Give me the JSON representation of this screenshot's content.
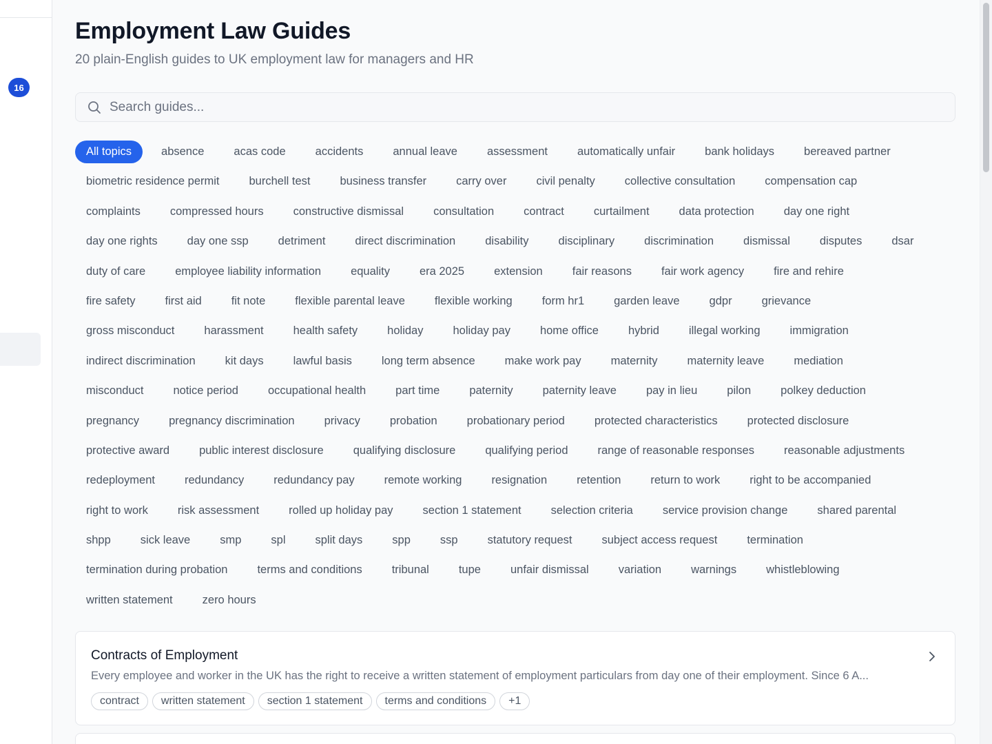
{
  "sidebar": {
    "badge_count": "16"
  },
  "header": {
    "title": "Employment Law Guides",
    "subtitle": "20 plain-English guides to UK employment law for managers and HR"
  },
  "search": {
    "placeholder": "Search guides..."
  },
  "topics": {
    "active": "All topics",
    "rows": [
      [
        "All topics",
        "absence",
        "acas code",
        "accidents",
        "annual leave",
        "assessment",
        "automatically unfair",
        "bank holidays",
        "bereaved partner"
      ],
      [
        "biometric residence permit",
        "burchell test",
        "business transfer",
        "carry over",
        "civil penalty",
        "collective consultation",
        "compensation cap"
      ],
      [
        "complaints",
        "compressed hours",
        "constructive dismissal",
        "consultation",
        "contract",
        "curtailment",
        "data protection",
        "day one right"
      ],
      [
        "day one rights",
        "day one ssp",
        "detriment",
        "direct discrimination",
        "disability",
        "disciplinary",
        "discrimination",
        "dismissal",
        "disputes",
        "dsar"
      ],
      [
        "duty of care",
        "employee liability information",
        "equality",
        "era 2025",
        "extension",
        "fair reasons",
        "fair work agency",
        "fire and rehire"
      ],
      [
        "fire safety",
        "first aid",
        "fit note",
        "flexible parental leave",
        "flexible working",
        "form hr1",
        "garden leave",
        "gdpr",
        "grievance"
      ],
      [
        "gross misconduct",
        "harassment",
        "health safety",
        "holiday",
        "holiday pay",
        "home office",
        "hybrid",
        "illegal working",
        "immigration"
      ],
      [
        "indirect discrimination",
        "kit days",
        "lawful basis",
        "long term absence",
        "make work pay",
        "maternity",
        "maternity leave",
        "mediation"
      ],
      [
        "misconduct",
        "notice period",
        "occupational health",
        "part time",
        "paternity",
        "paternity leave",
        "pay in lieu",
        "pilon",
        "polkey deduction"
      ],
      [
        "pregnancy",
        "pregnancy discrimination",
        "privacy",
        "probation",
        "probationary period",
        "protected characteristics",
        "protected disclosure"
      ],
      [
        "protective award",
        "public interest disclosure",
        "qualifying disclosure",
        "qualifying period",
        "range of reasonable responses",
        "reasonable adjustments"
      ],
      [
        "redeployment",
        "redundancy",
        "redundancy pay",
        "remote working",
        "resignation",
        "retention",
        "return to work",
        "right to be accompanied"
      ],
      [
        "right to work",
        "risk assessment",
        "rolled up holiday pay",
        "section 1 statement",
        "selection criteria",
        "service provision change",
        "shared parental"
      ],
      [
        "shpp",
        "sick leave",
        "smp",
        "spl",
        "split days",
        "spp",
        "ssp",
        "statutory request",
        "subject access request",
        "termination"
      ],
      [
        "termination during probation",
        "terms and conditions",
        "tribunal",
        "tupe",
        "unfair dismissal",
        "variation",
        "warnings",
        "whistleblowing"
      ],
      [
        "written statement",
        "zero hours"
      ]
    ]
  },
  "guides": [
    {
      "title": "Contracts of Employment",
      "excerpt": "Every employee and worker in the UK has the right to receive a written statement of employment particulars from day one of their employment. Since 6 A...",
      "tags": [
        "contract",
        "written statement",
        "section 1 statement",
        "terms and conditions",
        "+1"
      ]
    }
  ],
  "colors": {
    "accent": "#2563eb",
    "badge": "#1d4ed8",
    "muted_text": "#6b7280",
    "border": "#e5e7eb"
  },
  "icons": {
    "search": "search-icon",
    "chevron": "chevron-right-icon"
  }
}
